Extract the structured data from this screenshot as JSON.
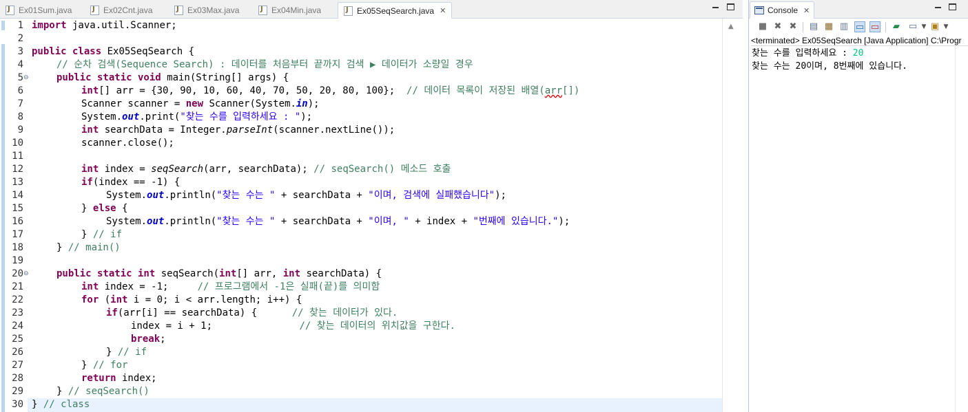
{
  "editor_tabs": [
    {
      "label": "Ex01Sum.java"
    },
    {
      "label": "Ex02Cnt.java"
    },
    {
      "label": "Ex03Max.java"
    },
    {
      "label": "Ex04Min.java"
    },
    {
      "label": "Ex05SeqSearch.java",
      "active": true
    }
  ],
  "close_glyph": "✕",
  "code": {
    "l1": {
      "kw": "import",
      "rest": " java.util.Scanner;"
    },
    "l3": {
      "kw": "public class",
      "rest": " Ex05SeqSearch {"
    },
    "l4": {
      "cm": "// 순차 검색(Sequence Search) : 데이터를 처음부터 끝까지 검색 ▶ 데이터가 소량일 경우"
    },
    "l5": {
      "kw": "public static void",
      "rest": " main(String[] args) {"
    },
    "l6": {
      "kw": "int",
      "rest": "[] arr = {30, 90, 10, 60, 40, 70, 50, 20, 80, 100};  ",
      "cm_a": "// 데이터 목록이 저장된 배열(",
      "cm_sq": "arr",
      "cm_b": "[])"
    },
    "l7": {
      "pre": "Scanner scanner = ",
      "kw": "new",
      "mid": " Scanner(System.",
      "fld": "in",
      "post": ");"
    },
    "l8": {
      "pre": "System.",
      "fld": "out",
      "mid": ".print(",
      "str": "\"찾는 수를 입력하세요 : \"",
      "post": ");"
    },
    "l9": {
      "kw": "int",
      "mid": " searchData = Integer.",
      "it": "parseInt",
      "post": "(scanner.nextLine());"
    },
    "l10": {
      "text": "scanner.close();"
    },
    "l12": {
      "kw": "int",
      "mid": " index = ",
      "it": "seqSearch",
      "post": "(arr, searchData); ",
      "cm": "// seqSearch() 메소드 호출"
    },
    "l13": {
      "kw": "if",
      "rest": "(index == -1) {"
    },
    "l14": {
      "pre": "System.",
      "fld": "out",
      "mid": ".println(",
      "str1": "\"찾는 수는 \"",
      "op": " + searchData + ",
      "str2": "\"이며, 검색에 실패했습니다\"",
      "post": ");"
    },
    "l15": {
      "pre": "} ",
      "kw": "else",
      "post": " {"
    },
    "l16": {
      "pre": "System.",
      "fld": "out",
      "mid": ".println(",
      "str1": "\"찾는 수는 \"",
      "op1": " + searchData + ",
      "str2": "\"이며, \"",
      "op2": " + index + ",
      "str3": "\"번째에 있습니다.\"",
      "post": ");"
    },
    "l17": {
      "pre": "} ",
      "cm": "// if"
    },
    "l18": {
      "pre": "} ",
      "cm": "// main()"
    },
    "l20": {
      "kw1": "public static int",
      "mid": " seqSearch(",
      "kw2": "int",
      "mid2": "[] arr, ",
      "kw3": "int",
      "post": " searchData) {"
    },
    "l21": {
      "kw": "int",
      "mid": " index = -1;     ",
      "cm": "// 프로그램에서 -1은 실패(끝)를 의미함"
    },
    "l22": {
      "kw1": "for",
      "mid1": " (",
      "kw2": "int",
      "post": " i = 0; i < arr.length; i++) {"
    },
    "l23": {
      "kw": "if",
      "mid": "(arr[i] == searchData) {      ",
      "cm": "// 찾는 데이터가 있다."
    },
    "l24": {
      "mid": "index = i + 1;               ",
      "cm": "// 찾는 데이터의 위치값을 구한다."
    },
    "l25": {
      "kw": "break",
      "post": ";"
    },
    "l26": {
      "pre": "} ",
      "cm": "// if"
    },
    "l27": {
      "pre": "} ",
      "cm": "// for"
    },
    "l28": {
      "kw": "return",
      "post": " index;"
    },
    "l29": {
      "pre": "} ",
      "cm": "// seqSearch()"
    },
    "l30": {
      "pre": "} ",
      "cm": "// class"
    }
  },
  "line_numbers": [
    "1",
    "2",
    "3",
    "4",
    "5",
    "6",
    "7",
    "8",
    "9",
    "10",
    "11",
    "12",
    "13",
    "14",
    "15",
    "16",
    "17",
    "18",
    "19",
    "20",
    "21",
    "22",
    "23",
    "24",
    "25",
    "26",
    "27",
    "28",
    "29",
    "30"
  ],
  "console": {
    "tab_label": "Console",
    "status": "<terminated> Ex05SeqSearch [Java Application] C:\\Progr",
    "prompt": "찾는 수를 입력하세요 : ",
    "input": "20",
    "result": "찾는 수는 20이며, 8번째에 있습니다."
  },
  "colors": {
    "keyword": "#7f0055",
    "string": "#2a00ff",
    "comment": "#3f7f5f",
    "field": "#0000c0",
    "console_input": "#00c87d"
  }
}
